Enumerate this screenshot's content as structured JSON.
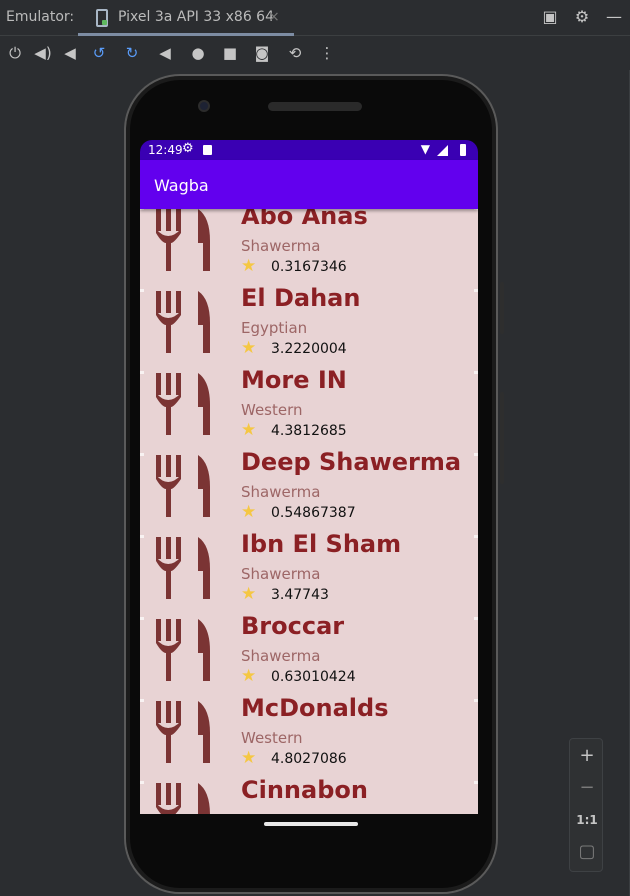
{
  "emulator": {
    "label": "Emulator:",
    "tab_title": "Pixel 3a API 33 x86 64",
    "tab_close": "×"
  },
  "zoom": {
    "plus": "+",
    "minus": "−",
    "one_to_one": "1:1"
  },
  "device": {
    "status": {
      "time": "12:49"
    },
    "app": {
      "title": "Wagba"
    },
    "restaurants": [
      {
        "name": "Abo Anas",
        "cuisine": "Shawerma",
        "rating": "0.3167346"
      },
      {
        "name": "El Dahan",
        "cuisine": "Egyptian",
        "rating": "3.2220004"
      },
      {
        "name": "More IN",
        "cuisine": "Western",
        "rating": "4.3812685"
      },
      {
        "name": "Deep Shawerma",
        "cuisine": "Shawerma",
        "rating": "0.54867387"
      },
      {
        "name": "Ibn El Sham",
        "cuisine": "Shawerma",
        "rating": "3.47743"
      },
      {
        "name": "Broccar",
        "cuisine": "Shawerma",
        "rating": "0.63010424"
      },
      {
        "name": "McDonalds",
        "cuisine": "Western",
        "rating": "4.8027086"
      },
      {
        "name": "Cinnabon",
        "cuisine": "",
        "rating": ""
      }
    ]
  },
  "colors": {
    "app_bar": "#6200ee",
    "status_bar": "#3a00b3",
    "list_bg": "#e8d3d4",
    "name_text": "#8b2024",
    "cuisine_text": "#9d6666",
    "cutlery_icon": "#7b3434",
    "star": "#f5c743"
  },
  "icons": {
    "toolbar": [
      "power-icon",
      "volume-up-icon",
      "volume-down-icon",
      "rotate-left-icon",
      "rotate-right-icon",
      "back-icon",
      "home-icon",
      "overview-icon",
      "screenshot-icon",
      "snapshot-icon",
      "more-icon"
    ],
    "row": [
      "cutlery-icon",
      "star-icon"
    ]
  }
}
